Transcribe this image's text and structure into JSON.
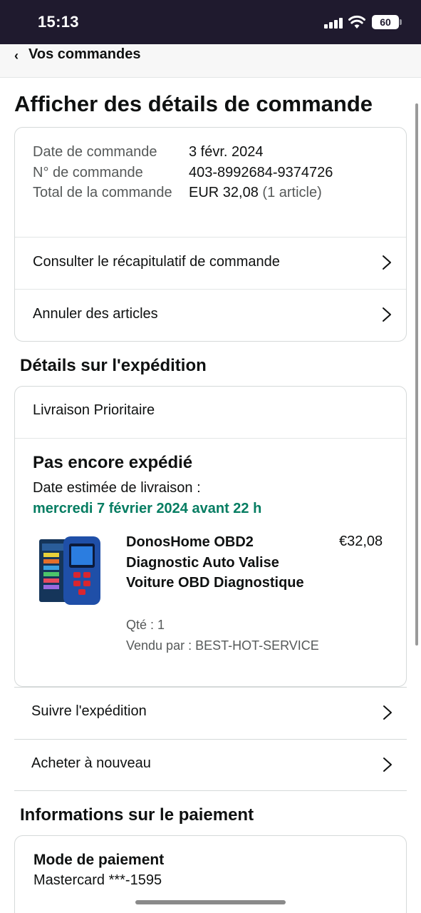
{
  "status_bar": {
    "time": "15:13",
    "battery": "60"
  },
  "nav": {
    "back_label": "Vos commandes"
  },
  "page": {
    "title": "Afficher des détails de commande"
  },
  "order": {
    "date_label": "Date de commande",
    "date_value": "3 févr. 2024",
    "number_label": "N° de commande",
    "number_value": "403-8992684-9374726",
    "total_label": "Total de la commande",
    "total_value": "EUR 32,08",
    "total_count": "(1 article)",
    "links": [
      "Consulter le récapitulatif de commande",
      "Annuler des articles"
    ]
  },
  "shipping": {
    "section_title": "Détails sur l'expédition",
    "method": "Livraison Prioritaire",
    "status": "Pas encore expédié",
    "estimate_label": "Date estimée de livraison :",
    "estimate_date": "mercredi 7 février 2024 avant 22 h",
    "product": {
      "title": "DonosHome OBD2 Diagnostic Auto Valise Voiture OBD Diagnostique",
      "price": "€32,08",
      "qty": "Qté : 1",
      "seller": "Vendu par : BEST-HOT-SERVICE"
    },
    "actions": [
      "Suivre l'expédition",
      "Acheter à nouveau"
    ]
  },
  "payment": {
    "section_title": "Informations sur le paiement",
    "method_label": "Mode de paiement",
    "method_value": "Mastercard  ***-1595"
  },
  "colors": {
    "accent_green": "#067d62",
    "status_bar": "#1f1a2e"
  }
}
